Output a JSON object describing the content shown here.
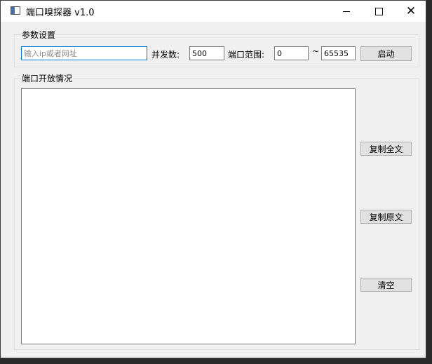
{
  "window": {
    "title": "端口嗅探器 v1.0",
    "controls": {
      "minimize": "minimize-icon",
      "maximize": "maximize-icon",
      "close": "close-icon"
    }
  },
  "params_group": {
    "label": "参数设置",
    "host_input": {
      "value": "",
      "placeholder": "输入ip或者网址"
    },
    "concurrency": {
      "label": "并发数:",
      "value": "500"
    },
    "port_range": {
      "label": "端口范围:",
      "start": "0",
      "separator": "~",
      "end": "65535"
    },
    "start_button": "启动"
  },
  "status_group": {
    "label": "端口开放情况",
    "output_text": ""
  },
  "actions": {
    "copy_all": "复制全文",
    "copy_raw": "复制原文",
    "clear": "清空"
  },
  "colors": {
    "focus_border": "#0078d7",
    "window_bg": "#f0f0f0",
    "button_bg": "#e1e1e1"
  }
}
